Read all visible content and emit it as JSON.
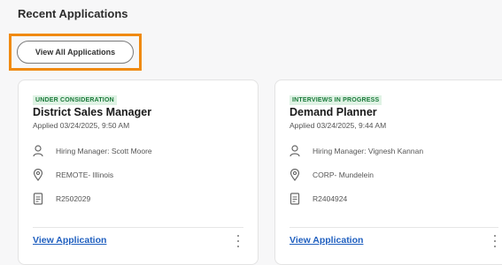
{
  "section": {
    "title": "Recent Applications",
    "view_all_label": "View All Applications"
  },
  "colors": {
    "highlight": "#f08a10",
    "status_bg": "#dff2e4",
    "status_text": "#1a7a3a",
    "link": "#1f5fbf"
  },
  "cards": [
    {
      "status": "UNDER CONSIDERATION",
      "title": "District Sales Manager",
      "applied": "Applied 03/24/2025, 9:50 AM",
      "hiring_manager": "Hiring Manager: Scott Moore",
      "location": "REMOTE- Illinois",
      "requisition": "R2502029",
      "link_label": "View Application",
      "icons": [
        "person-icon",
        "location-pin-icon",
        "document-icon",
        "more-vertical-icon"
      ]
    },
    {
      "status": "INTERVIEWS IN PROGRESS",
      "title": "Demand Planner",
      "applied": "Applied 03/24/2025, 9:44 AM",
      "hiring_manager": "Hiring Manager: Vignesh Kannan",
      "location": "CORP- Mundelein",
      "requisition": "R2404924",
      "link_label": "View Application",
      "icons": [
        "person-icon",
        "location-pin-icon",
        "document-icon",
        "more-vertical-icon"
      ]
    }
  ]
}
